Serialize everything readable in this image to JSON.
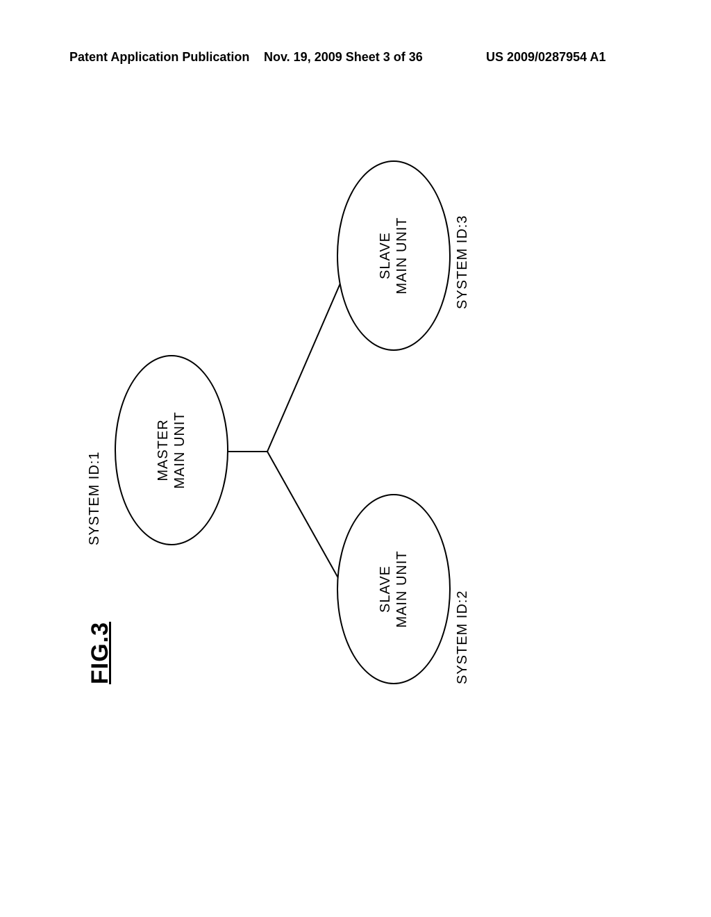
{
  "header": {
    "left": "Patent Application Publication",
    "mid": "Nov. 19, 2009  Sheet 3 of 36",
    "right": "US 2009/0287954 A1"
  },
  "figure": {
    "title": "FIG.3",
    "nodes": {
      "master": {
        "label_line1": "MASTER",
        "label_line2": "MAIN UNIT",
        "system_id_label": "SYSTEM ID:1"
      },
      "slave1": {
        "label_line1": "SLAVE",
        "label_line2": "MAIN UNIT",
        "system_id_label": "SYSTEM ID:2"
      },
      "slave2": {
        "label_line1": "SLAVE",
        "label_line2": "MAIN UNIT",
        "system_id_label": "SYSTEM ID:3"
      }
    }
  }
}
